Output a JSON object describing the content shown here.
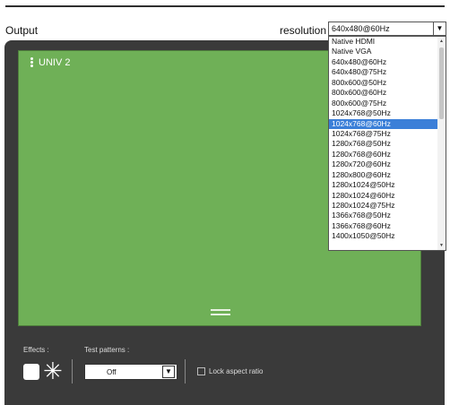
{
  "header": {
    "title": "Output",
    "resolution_label": "resolution",
    "resolution_value": "640x480@60Hz",
    "dropdown_arrow": "▼"
  },
  "dropdown": {
    "options": [
      "Native HDMI",
      "Native VGA",
      "640x480@60Hz",
      "640x480@75Hz",
      "800x600@50Hz",
      "800x600@60Hz",
      "800x600@75Hz",
      "1024x768@50Hz",
      "1024x768@60Hz",
      "1024x768@75Hz",
      "1280x768@50Hz",
      "1280x768@60Hz",
      "1280x720@60Hz",
      "1280x800@60Hz",
      "1280x1024@50Hz",
      "1280x1024@60Hz",
      "1280x1024@75Hz",
      "1366x768@50Hz",
      "1366x768@60Hz",
      "1400x1050@50Hz"
    ],
    "highlighted": "1024x768@60Hz",
    "scroll_up": "▲",
    "scroll_down": "▼"
  },
  "canvas": {
    "layer_label": "UNIV 2",
    "color": "#6fb057"
  },
  "footer": {
    "effects_label": "Effects :",
    "star_glyph": "✳",
    "test_patterns_label": "Test patterns :",
    "test_pattern_value": "Off",
    "test_pattern_arrow": "▼",
    "lock_aspect_label": "Lock aspect ratio",
    "lock_aspect_checked": false
  },
  "colors": {
    "panel": "#3a3a3a",
    "highlight": "#3b7fd8"
  },
  "icons": [
    "kebab-menu-icon",
    "drag-handle-icon",
    "effect-square-icon",
    "asterisk-icon",
    "chevron-down-icon"
  ]
}
